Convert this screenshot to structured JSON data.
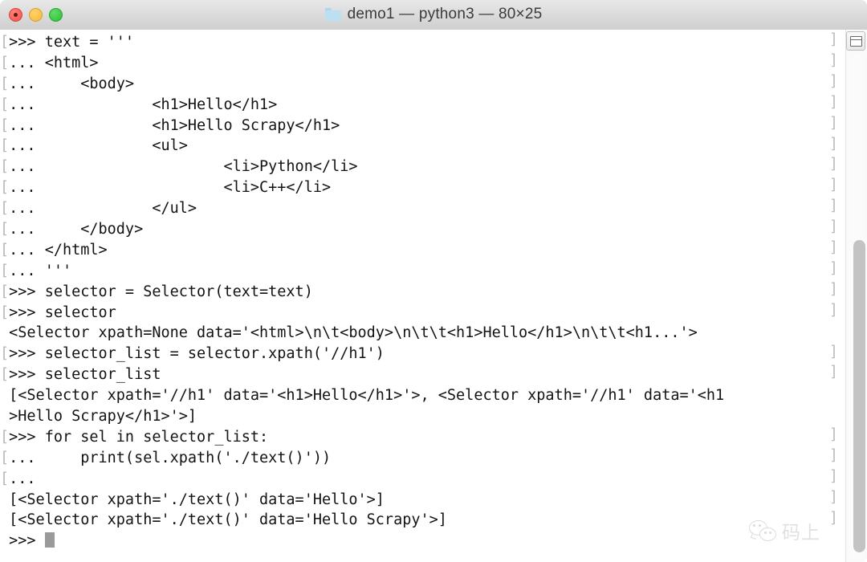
{
  "window": {
    "title": "demo1 — python3 — 80×25",
    "folder_icon": "folder-icon",
    "traffic_lights": [
      {
        "name": "close-button",
        "color": "#f0544a"
      },
      {
        "name": "minimize-button",
        "color": "#f6b93b"
      },
      {
        "name": "zoom-button",
        "color": "#28c231"
      }
    ]
  },
  "terminal": {
    "columns": 80,
    "rows": 25,
    "background": "#ffffff",
    "foreground": "#131313",
    "wrap_marker_color": "#bdbdbd",
    "cursor_color": "#9a9a9a",
    "lines": [
      {
        "marker": "[",
        "text": ">>> text = '''",
        "end_marker": "]"
      },
      {
        "marker": "[",
        "text": "... <html>",
        "end_marker": "]"
      },
      {
        "marker": "[",
        "text": "...     <body>",
        "end_marker": "]"
      },
      {
        "marker": "[",
        "text": "...             <h1>Hello</h1>",
        "end_marker": "]"
      },
      {
        "marker": "[",
        "text": "...             <h1>Hello Scrapy</h1>",
        "end_marker": "]"
      },
      {
        "marker": "[",
        "text": "...             <ul>",
        "end_marker": "]"
      },
      {
        "marker": "[",
        "text": "...                     <li>Python</li>",
        "end_marker": "]"
      },
      {
        "marker": "[",
        "text": "...                     <li>C++</li>",
        "end_marker": "]"
      },
      {
        "marker": "[",
        "text": "...             </ul>",
        "end_marker": "]"
      },
      {
        "marker": "[",
        "text": "...     </body>",
        "end_marker": "]"
      },
      {
        "marker": "[",
        "text": "... </html>",
        "end_marker": "]"
      },
      {
        "marker": "[",
        "text": "... '''",
        "end_marker": "]"
      },
      {
        "marker": "[",
        "text": ">>> selector = Selector(text=text)",
        "end_marker": "]"
      },
      {
        "marker": "[",
        "text": ">>> selector",
        "end_marker": "]"
      },
      {
        "marker": " ",
        "text": "<Selector xpath=None data='<html>\\n\\t<body>\\n\\t\\t<h1>Hello</h1>\\n\\t\\t<h1...'>",
        "end_marker": ""
      },
      {
        "marker": "[",
        "text": ">>> selector_list = selector.xpath('//h1')",
        "end_marker": "]"
      },
      {
        "marker": "[",
        "text": ">>> selector_list",
        "end_marker": "]"
      },
      {
        "marker": " ",
        "text": "[<Selector xpath='//h1' data='<h1>Hello</h1>'>, <Selector xpath='//h1' data='<h1",
        "end_marker": ""
      },
      {
        "marker": " ",
        "text": ">Hello Scrapy</h1>'>]",
        "end_marker": ""
      },
      {
        "marker": "[",
        "text": ">>> for sel in selector_list:",
        "end_marker": "]"
      },
      {
        "marker": "[",
        "text": "...     print(sel.xpath('./text()'))",
        "end_marker": "]"
      },
      {
        "marker": "[",
        "text": "...",
        "end_marker": "]"
      },
      {
        "marker": " ",
        "text": "[<Selector xpath='./text()' data='Hello'>]",
        "end_marker": "]"
      },
      {
        "marker": " ",
        "text": "[<Selector xpath='./text()' data='Hello Scrapy'>]",
        "end_marker": "]"
      },
      {
        "marker": " ",
        "text": ">>> ",
        "end_marker": "",
        "cursor": true
      }
    ]
  },
  "scrollbar": {
    "split_pane_button": "split-pane-icon"
  },
  "watermark": {
    "text": "码上",
    "icon": "wechat-icon"
  }
}
